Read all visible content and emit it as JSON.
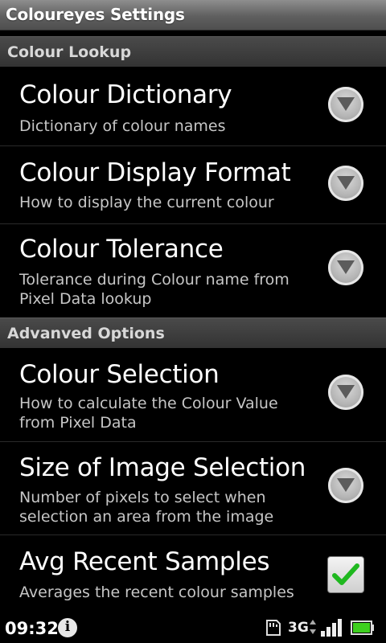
{
  "app": {
    "title": "Coloureyes Settings"
  },
  "sections": [
    {
      "header": "Colour Lookup",
      "items": [
        {
          "title": "Colour Dictionary",
          "summary": "Dictionary of colour names",
          "widget": "dropdown"
        },
        {
          "title": "Colour Display Format",
          "summary": "How to display the current colour",
          "widget": "dropdown"
        },
        {
          "title": "Colour Tolerance",
          "summary": "Tolerance during Colour name from Pixel Data lookup",
          "widget": "dropdown"
        }
      ]
    },
    {
      "header": "Advanved Options",
      "items": [
        {
          "title": "Colour Selection",
          "summary": "How to calculate the Colour Value from Pixel Data",
          "widget": "dropdown"
        },
        {
          "title": "Size of Image Selection",
          "summary": "Number of pixels to select when selection an area from the image",
          "widget": "dropdown"
        },
        {
          "title": "Avg Recent Samples",
          "summary": "Averages the recent colour samples",
          "widget": "checkbox",
          "checked": true
        }
      ]
    }
  ],
  "statusbar": {
    "time": "09:32",
    "network": "3G",
    "icons": [
      "info-icon",
      "sd-card-icon",
      "data-arrows-icon",
      "signal-icon",
      "battery-icon"
    ]
  },
  "colors": {
    "accent_check": "#1fb81f",
    "battery": "#3ecf1f"
  }
}
